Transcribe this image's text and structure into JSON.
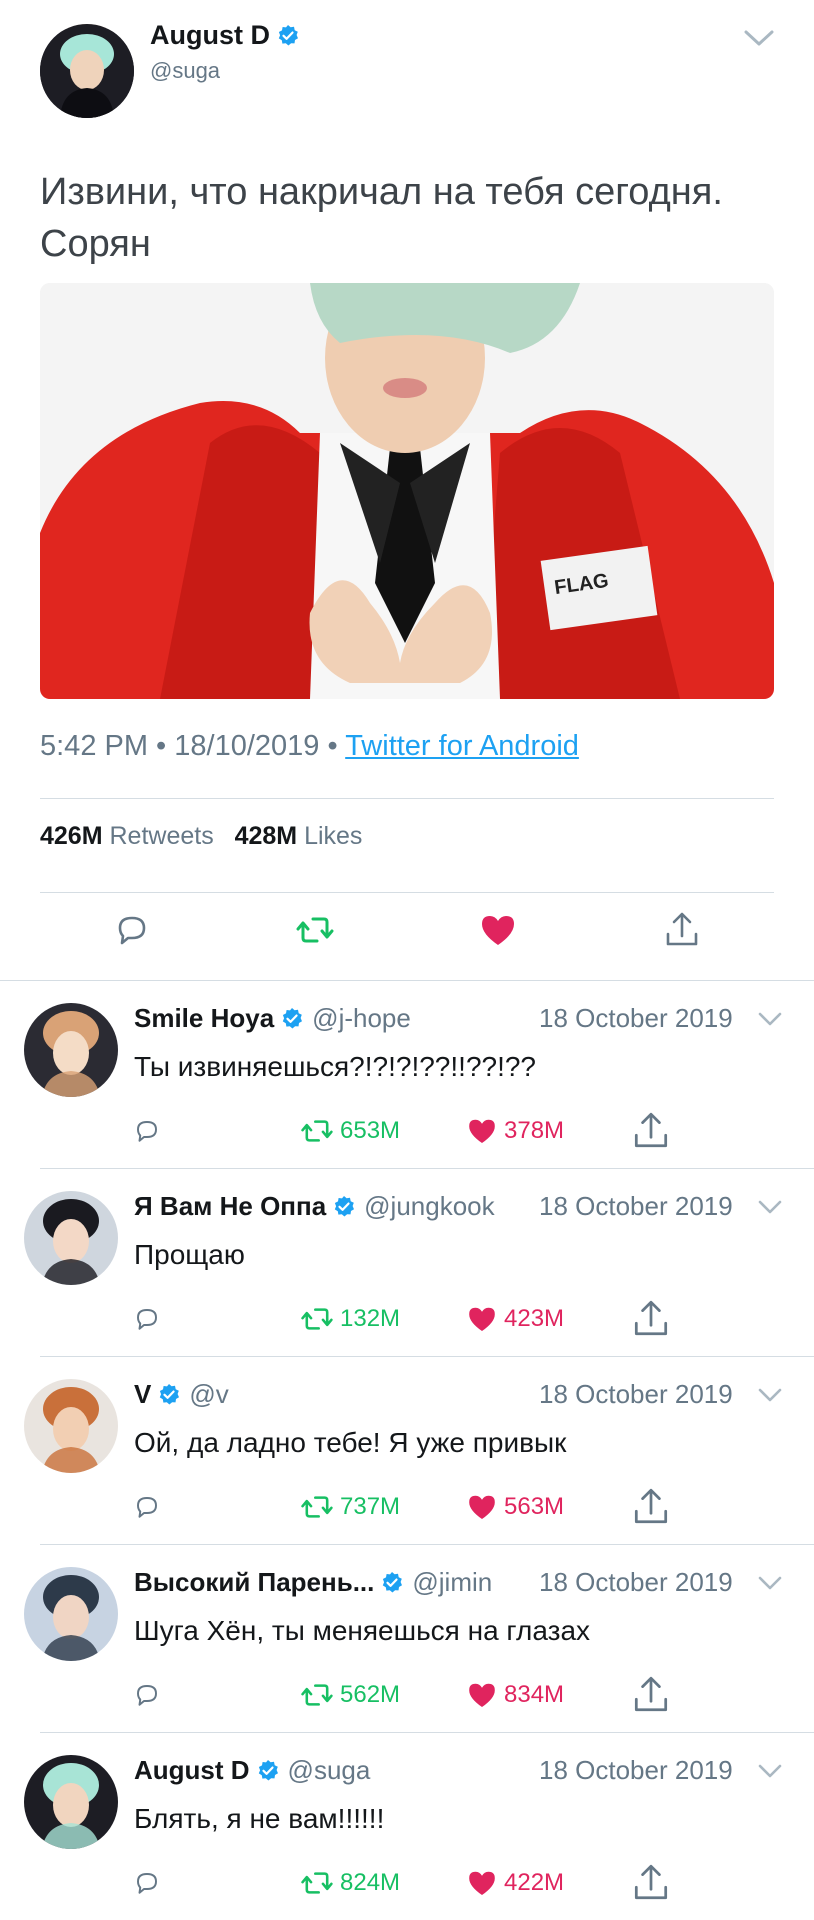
{
  "main_tweet": {
    "author_name": "August D",
    "author_handle": "@suga",
    "text": "Извини, что накричал на тебя сегодня. Сорян",
    "time": "5:42 PM",
    "date": "18/10/2019",
    "source": "Twitter for Android",
    "separator": " • ",
    "retweets_count": "426M",
    "retweets_label": "Retweets",
    "likes_count": "428M",
    "likes_label": "Likes",
    "icons": [
      "reply-icon",
      "retweet-icon",
      "like-icon-filled",
      "share-icon"
    ]
  },
  "colors": {
    "verified": "#1da1f2",
    "retweet": "#17bf63",
    "like": "#e0245e",
    "secondary": "#657786",
    "link": "#1da1f2"
  },
  "replies": [
    {
      "name": "Smile Hoya",
      "handle": "@j-hope",
      "date": "18 October 2019",
      "text": "Ты извиняешься?!?!?!??!!??!??",
      "retweets": "653M",
      "likes": "378M"
    },
    {
      "name": "Я Вам Не Оппа",
      "handle": "@jungkook",
      "date": "18 October 2019",
      "text": "Прощаю",
      "retweets": "132M",
      "likes": "423M"
    },
    {
      "name": "V",
      "handle": "@v",
      "date": "18 October 2019",
      "text": "Ой, да ладно тебе! Я уже привык",
      "retweets": "737M",
      "likes": "563M"
    },
    {
      "name": "Высокий Парень...",
      "handle": "@jimin",
      "date": "18 October 2019",
      "text": "Шуга Хён, ты меняешься на глазах",
      "retweets": "562M",
      "likes": "834M"
    },
    {
      "name": "August D",
      "handle": "@suga",
      "date": "18 October 2019",
      "text": "Блять, я не вам!!!!!!",
      "retweets": "824M",
      "likes": "422M"
    }
  ]
}
